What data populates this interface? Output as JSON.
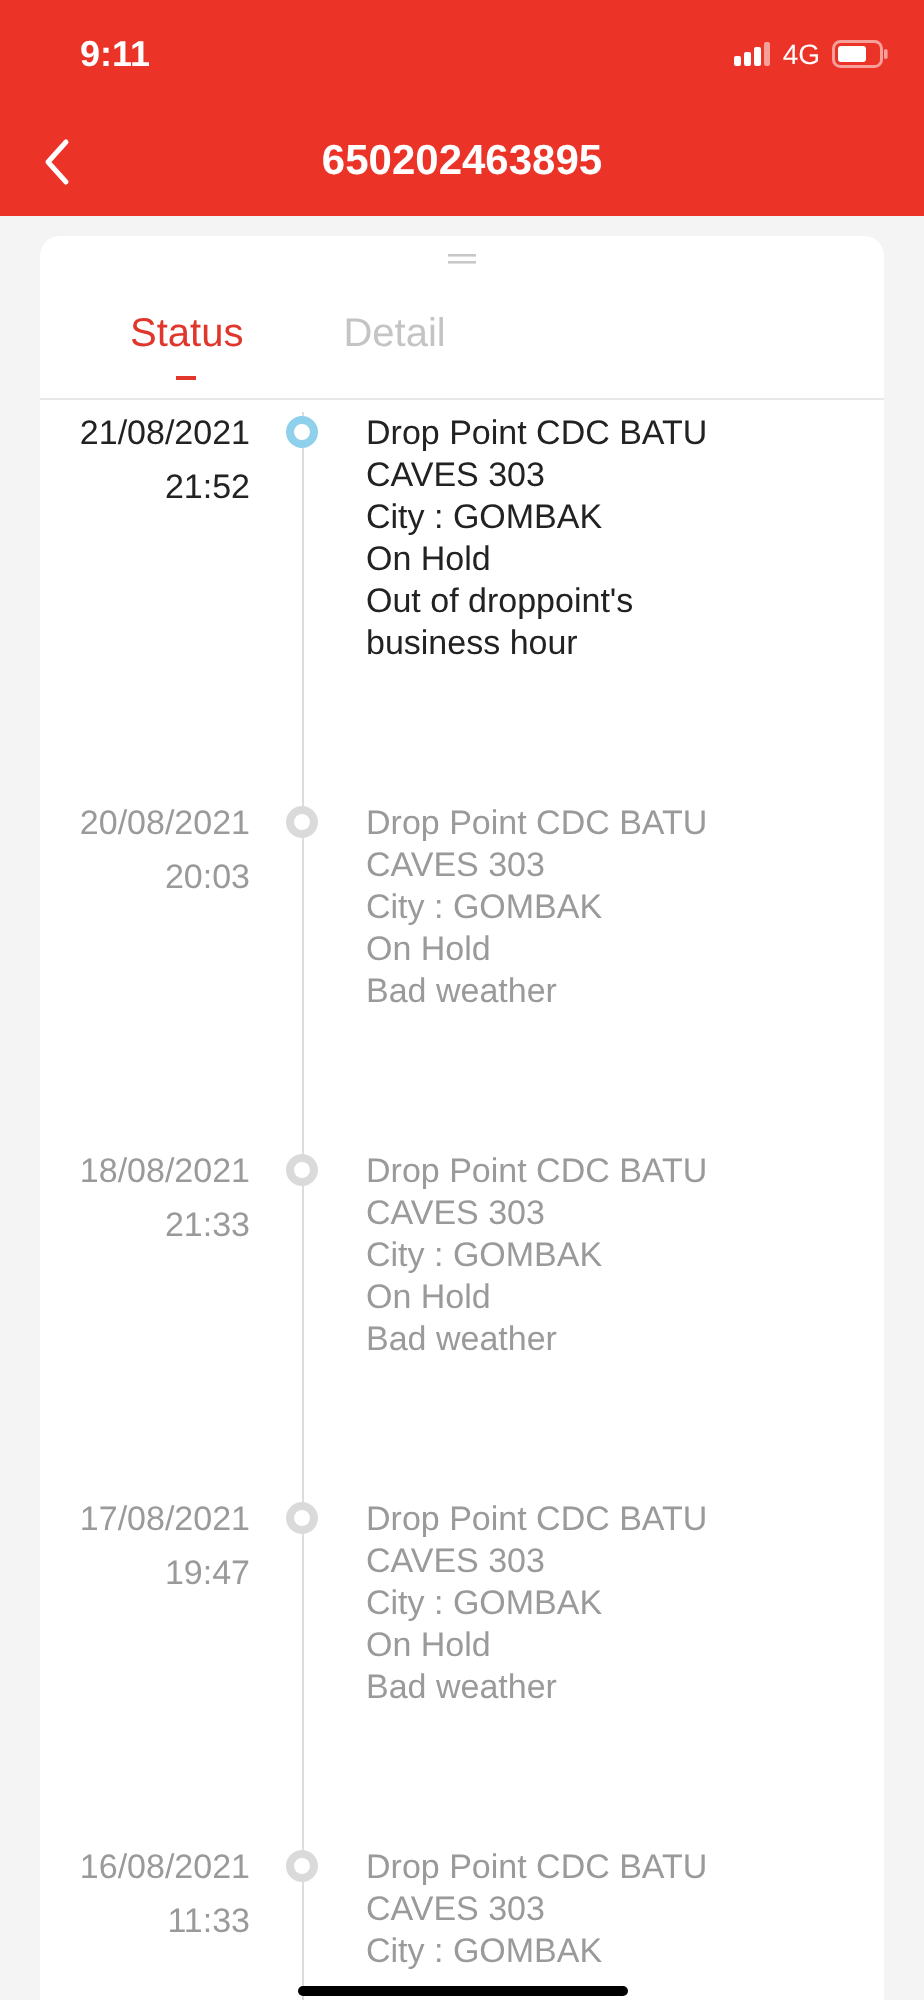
{
  "status_bar": {
    "time": "9:11",
    "network": "4G"
  },
  "header": {
    "title": "650202463895"
  },
  "tabs": [
    {
      "label": "Status",
      "selected": true
    },
    {
      "label": "Detail",
      "selected": false
    }
  ],
  "events": [
    {
      "date": "21/08/2021",
      "time": "21:52",
      "current": true,
      "lines": [
        "Drop Point CDC BATU",
        "CAVES 303",
        "City : GOMBAK",
        "On Hold",
        "Out of droppoint's",
        "business hour"
      ]
    },
    {
      "date": "20/08/2021",
      "time": "20:03",
      "current": false,
      "lines": [
        "Drop Point CDC BATU",
        "CAVES 303",
        "City : GOMBAK",
        "On Hold",
        "Bad weather"
      ]
    },
    {
      "date": "18/08/2021",
      "time": "21:33",
      "current": false,
      "lines": [
        "Drop Point CDC BATU",
        "CAVES 303",
        "City : GOMBAK",
        "On Hold",
        "Bad weather"
      ]
    },
    {
      "date": "17/08/2021",
      "time": "19:47",
      "current": false,
      "lines": [
        "Drop Point CDC BATU",
        "CAVES 303",
        "City : GOMBAK",
        "On Hold",
        "Bad weather"
      ]
    },
    {
      "date": "16/08/2021",
      "time": "11:33",
      "current": false,
      "lines": [
        "Drop Point CDC BATU",
        "CAVES 303",
        "City : GOMBAK"
      ]
    }
  ]
}
